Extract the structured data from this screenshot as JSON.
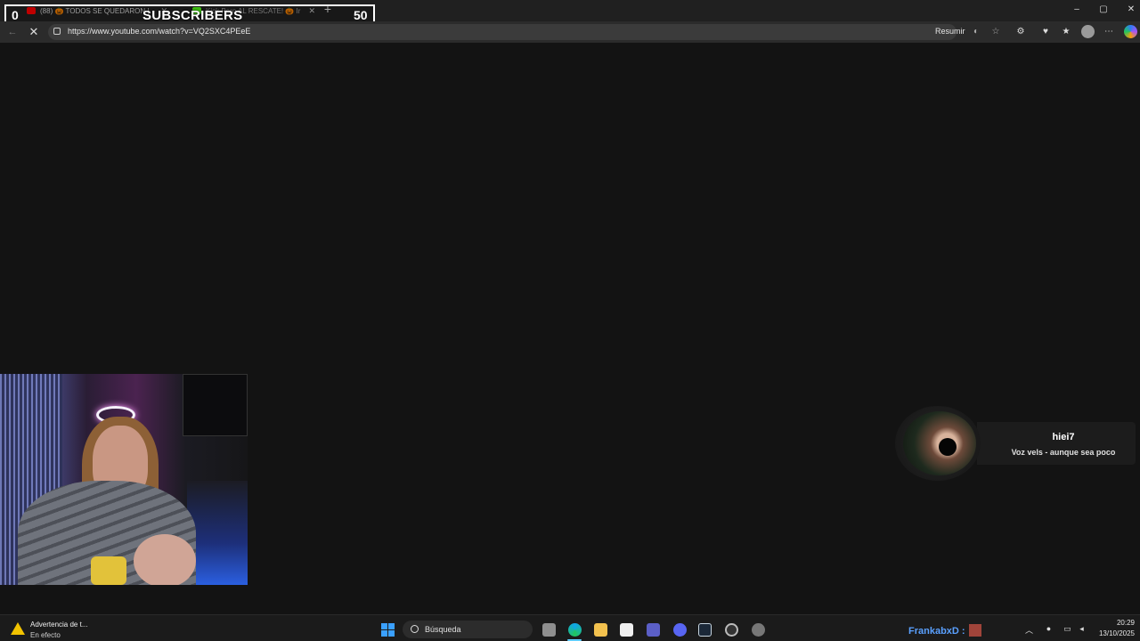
{
  "browser": {
    "tabs": [
      {
        "label": "(88) 🎃 TODOS SE QUEDARON |",
        "favicon_color": "#ff0000"
      },
      {
        "label": "Kick Pero AL RESCATE! 🎃 Ir",
        "favicon_color": "#53fc18"
      }
    ],
    "new_tab_symbol": "+",
    "window_controls": {
      "minimize": "–",
      "maximize": "▢",
      "close": "✕"
    },
    "nav": {
      "back": "←",
      "reload": "✕"
    },
    "url": "https://www.youtube.com/watch?v=VQ2SXC4PEeE",
    "summarize_label": "Resumir",
    "toolbar_icons": [
      "read-aloud-icon",
      "favorite-star-icon",
      "extensions-icon",
      "performance-icon",
      "favorites-icon",
      "profile-icon",
      "more-icon",
      "copilot-icon"
    ]
  },
  "subscriber_goal": {
    "min": "0",
    "title": "SUBSCRIBERS",
    "max": "50"
  },
  "alert": {
    "username": "hiei7",
    "message": "Voz vels - aunque sea poco"
  },
  "taskbar": {
    "notification_title": "Advertencia de t...",
    "notification_sub": "En efecto",
    "search_placeholder": "Búsqueda",
    "viewer_name": "FrankabxD :",
    "time": "20:29",
    "date": "13/10/2025"
  }
}
